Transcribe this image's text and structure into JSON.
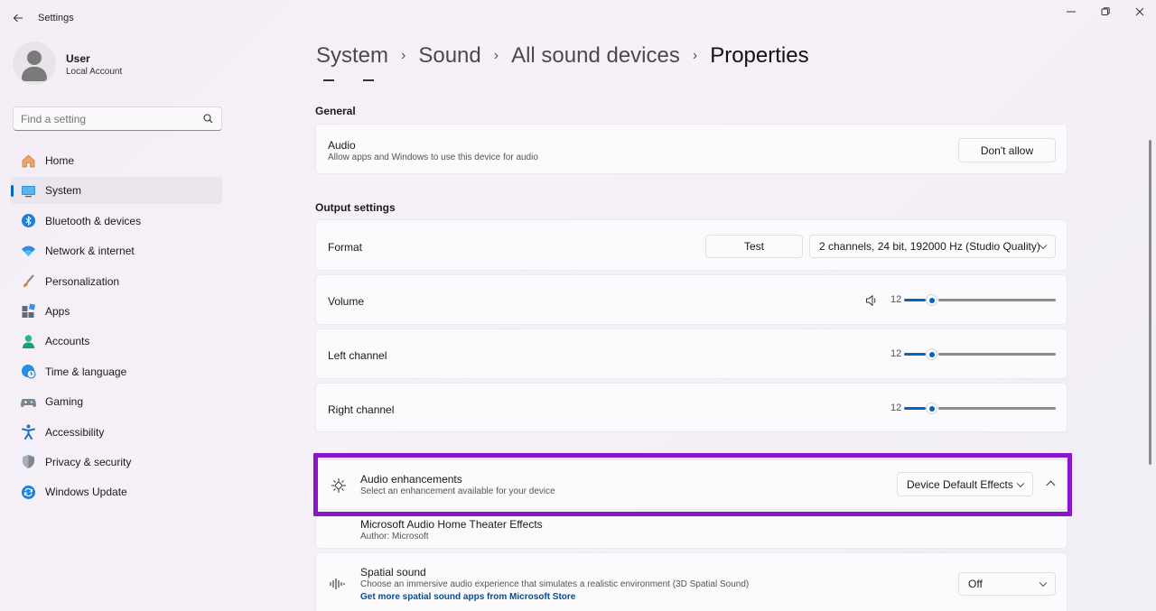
{
  "window": {
    "title": "Settings",
    "back_icon": "arrow-left-icon",
    "minimize_icon": "minimize-icon",
    "maximize_icon": "restore-icon",
    "close_icon": "close-icon"
  },
  "profile": {
    "name": "User",
    "account_type": "Local Account"
  },
  "search": {
    "placeholder": "Find a setting",
    "icon": "search-icon"
  },
  "sidebar": {
    "active_index": 1,
    "items": [
      {
        "label": "Home",
        "icon": "home-icon"
      },
      {
        "label": "System",
        "icon": "system-icon"
      },
      {
        "label": "Bluetooth & devices",
        "icon": "bluetooth-icon"
      },
      {
        "label": "Network & internet",
        "icon": "wifi-icon"
      },
      {
        "label": "Personalization",
        "icon": "brush-icon"
      },
      {
        "label": "Apps",
        "icon": "apps-icon"
      },
      {
        "label": "Accounts",
        "icon": "accounts-icon"
      },
      {
        "label": "Time & language",
        "icon": "globe-clock-icon"
      },
      {
        "label": "Gaming",
        "icon": "gamepad-icon"
      },
      {
        "label": "Accessibility",
        "icon": "accessibility-icon"
      },
      {
        "label": "Privacy & security",
        "icon": "shield-icon"
      },
      {
        "label": "Windows Update",
        "icon": "update-icon"
      }
    ]
  },
  "breadcrumb": {
    "items": [
      "System",
      "Sound",
      "All sound devices",
      "Properties"
    ],
    "separator": "›"
  },
  "general": {
    "heading": "General",
    "audio": {
      "title": "Audio",
      "description": "Allow apps and Windows to use this device for audio",
      "button": "Don't allow"
    }
  },
  "output": {
    "heading": "Output settings",
    "format": {
      "title": "Format",
      "test_button": "Test",
      "selected": "2 channels, 24 bit, 192000 Hz (Studio Quality)"
    },
    "volume": {
      "title": "Volume",
      "value": "12",
      "level": 0.12,
      "icon": "speaker-icon"
    },
    "left_channel": {
      "title": "Left channel",
      "value": "12",
      "level": 0.12
    },
    "right_channel": {
      "title": "Right channel",
      "value": "12",
      "level": 0.12
    }
  },
  "enhancements": {
    "title": "Audio enhancements",
    "description": "Select an enhancement available for your device",
    "selected": "Device Default Effects",
    "icon": "enhancement-icon",
    "highlight_color": "#8b16c9"
  },
  "effect": {
    "title": "Microsoft Audio Home Theater Effects",
    "author": "Author: Microsoft"
  },
  "spatial": {
    "title": "Spatial sound",
    "description": "Choose an immersive audio experience that simulates a realistic environment (3D Spatial Sound)",
    "link": "Get more spatial sound apps from Microsoft Store",
    "selected": "Off",
    "icon": "spatial-sound-icon"
  },
  "colors": {
    "accent": "#0067c0",
    "highlight": "#8b16c9"
  }
}
